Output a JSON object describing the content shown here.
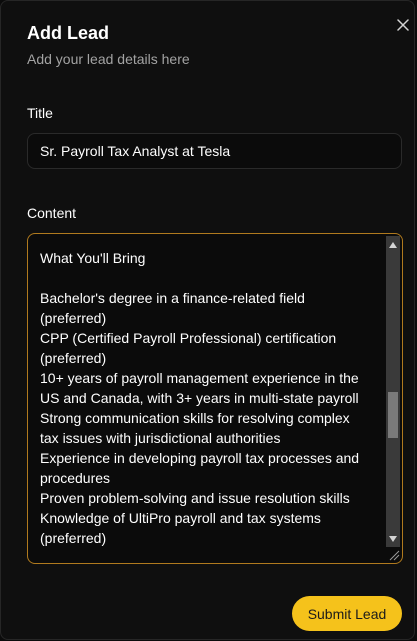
{
  "dialog": {
    "title": "Add Lead",
    "subtitle": "Add your lead details here",
    "close_icon": "close-icon"
  },
  "form": {
    "title_label": "Title",
    "title_value": "Sr. Payroll Tax Analyst at Tesla",
    "content_label": "Content",
    "content_value": "What You'll Bring\n\nBachelor's degree in a finance-related field (preferred)\nCPP (Certified Payroll Professional) certification (preferred)\n10+ years of payroll management experience in the US and Canada, with 3+ years in multi-state payroll\nStrong communication skills for resolving complex tax issues with jurisdictional authorities\nExperience in developing payroll tax processes and procedures\nProven problem-solving and issue resolution skills\nKnowledge of UltiPro payroll and tax systems (preferred)",
    "submit_label": "Submit Lead"
  },
  "colors": {
    "accent": "#f5c21b",
    "focus_border": "#b07a1e",
    "background": "#0f0f0f",
    "muted_text": "#a3a3a3"
  }
}
